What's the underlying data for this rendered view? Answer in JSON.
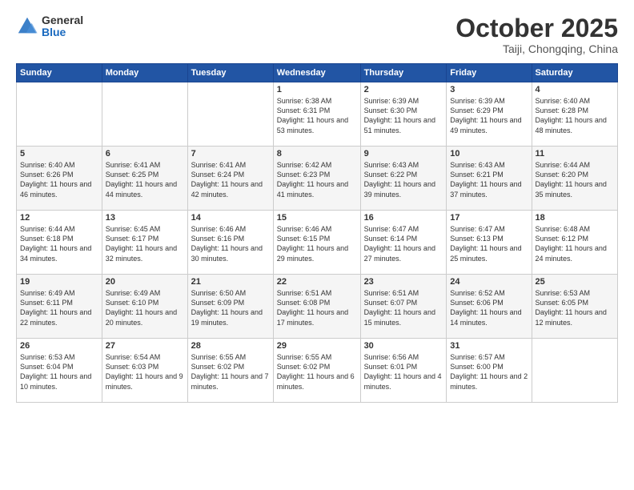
{
  "header": {
    "logo_general": "General",
    "logo_blue": "Blue",
    "month": "October 2025",
    "location": "Taiji, Chongqing, China"
  },
  "weekdays": [
    "Sunday",
    "Monday",
    "Tuesday",
    "Wednesday",
    "Thursday",
    "Friday",
    "Saturday"
  ],
  "weeks": [
    [
      {
        "day": "",
        "info": ""
      },
      {
        "day": "",
        "info": ""
      },
      {
        "day": "",
        "info": ""
      },
      {
        "day": "1",
        "info": "Sunrise: 6:38 AM\nSunset: 6:31 PM\nDaylight: 11 hours and 53 minutes."
      },
      {
        "day": "2",
        "info": "Sunrise: 6:39 AM\nSunset: 6:30 PM\nDaylight: 11 hours and 51 minutes."
      },
      {
        "day": "3",
        "info": "Sunrise: 6:39 AM\nSunset: 6:29 PM\nDaylight: 11 hours and 49 minutes."
      },
      {
        "day": "4",
        "info": "Sunrise: 6:40 AM\nSunset: 6:28 PM\nDaylight: 11 hours and 48 minutes."
      }
    ],
    [
      {
        "day": "5",
        "info": "Sunrise: 6:40 AM\nSunset: 6:26 PM\nDaylight: 11 hours and 46 minutes."
      },
      {
        "day": "6",
        "info": "Sunrise: 6:41 AM\nSunset: 6:25 PM\nDaylight: 11 hours and 44 minutes."
      },
      {
        "day": "7",
        "info": "Sunrise: 6:41 AM\nSunset: 6:24 PM\nDaylight: 11 hours and 42 minutes."
      },
      {
        "day": "8",
        "info": "Sunrise: 6:42 AM\nSunset: 6:23 PM\nDaylight: 11 hours and 41 minutes."
      },
      {
        "day": "9",
        "info": "Sunrise: 6:43 AM\nSunset: 6:22 PM\nDaylight: 11 hours and 39 minutes."
      },
      {
        "day": "10",
        "info": "Sunrise: 6:43 AM\nSunset: 6:21 PM\nDaylight: 11 hours and 37 minutes."
      },
      {
        "day": "11",
        "info": "Sunrise: 6:44 AM\nSunset: 6:20 PM\nDaylight: 11 hours and 35 minutes."
      }
    ],
    [
      {
        "day": "12",
        "info": "Sunrise: 6:44 AM\nSunset: 6:18 PM\nDaylight: 11 hours and 34 minutes."
      },
      {
        "day": "13",
        "info": "Sunrise: 6:45 AM\nSunset: 6:17 PM\nDaylight: 11 hours and 32 minutes."
      },
      {
        "day": "14",
        "info": "Sunrise: 6:46 AM\nSunset: 6:16 PM\nDaylight: 11 hours and 30 minutes."
      },
      {
        "day": "15",
        "info": "Sunrise: 6:46 AM\nSunset: 6:15 PM\nDaylight: 11 hours and 29 minutes."
      },
      {
        "day": "16",
        "info": "Sunrise: 6:47 AM\nSunset: 6:14 PM\nDaylight: 11 hours and 27 minutes."
      },
      {
        "day": "17",
        "info": "Sunrise: 6:47 AM\nSunset: 6:13 PM\nDaylight: 11 hours and 25 minutes."
      },
      {
        "day": "18",
        "info": "Sunrise: 6:48 AM\nSunset: 6:12 PM\nDaylight: 11 hours and 24 minutes."
      }
    ],
    [
      {
        "day": "19",
        "info": "Sunrise: 6:49 AM\nSunset: 6:11 PM\nDaylight: 11 hours and 22 minutes."
      },
      {
        "day": "20",
        "info": "Sunrise: 6:49 AM\nSunset: 6:10 PM\nDaylight: 11 hours and 20 minutes."
      },
      {
        "day": "21",
        "info": "Sunrise: 6:50 AM\nSunset: 6:09 PM\nDaylight: 11 hours and 19 minutes."
      },
      {
        "day": "22",
        "info": "Sunrise: 6:51 AM\nSunset: 6:08 PM\nDaylight: 11 hours and 17 minutes."
      },
      {
        "day": "23",
        "info": "Sunrise: 6:51 AM\nSunset: 6:07 PM\nDaylight: 11 hours and 15 minutes."
      },
      {
        "day": "24",
        "info": "Sunrise: 6:52 AM\nSunset: 6:06 PM\nDaylight: 11 hours and 14 minutes."
      },
      {
        "day": "25",
        "info": "Sunrise: 6:53 AM\nSunset: 6:05 PM\nDaylight: 11 hours and 12 minutes."
      }
    ],
    [
      {
        "day": "26",
        "info": "Sunrise: 6:53 AM\nSunset: 6:04 PM\nDaylight: 11 hours and 10 minutes."
      },
      {
        "day": "27",
        "info": "Sunrise: 6:54 AM\nSunset: 6:03 PM\nDaylight: 11 hours and 9 minutes."
      },
      {
        "day": "28",
        "info": "Sunrise: 6:55 AM\nSunset: 6:02 PM\nDaylight: 11 hours and 7 minutes."
      },
      {
        "day": "29",
        "info": "Sunrise: 6:55 AM\nSunset: 6:02 PM\nDaylight: 11 hours and 6 minutes."
      },
      {
        "day": "30",
        "info": "Sunrise: 6:56 AM\nSunset: 6:01 PM\nDaylight: 11 hours and 4 minutes."
      },
      {
        "day": "31",
        "info": "Sunrise: 6:57 AM\nSunset: 6:00 PM\nDaylight: 11 hours and 2 minutes."
      },
      {
        "day": "",
        "info": ""
      }
    ]
  ]
}
